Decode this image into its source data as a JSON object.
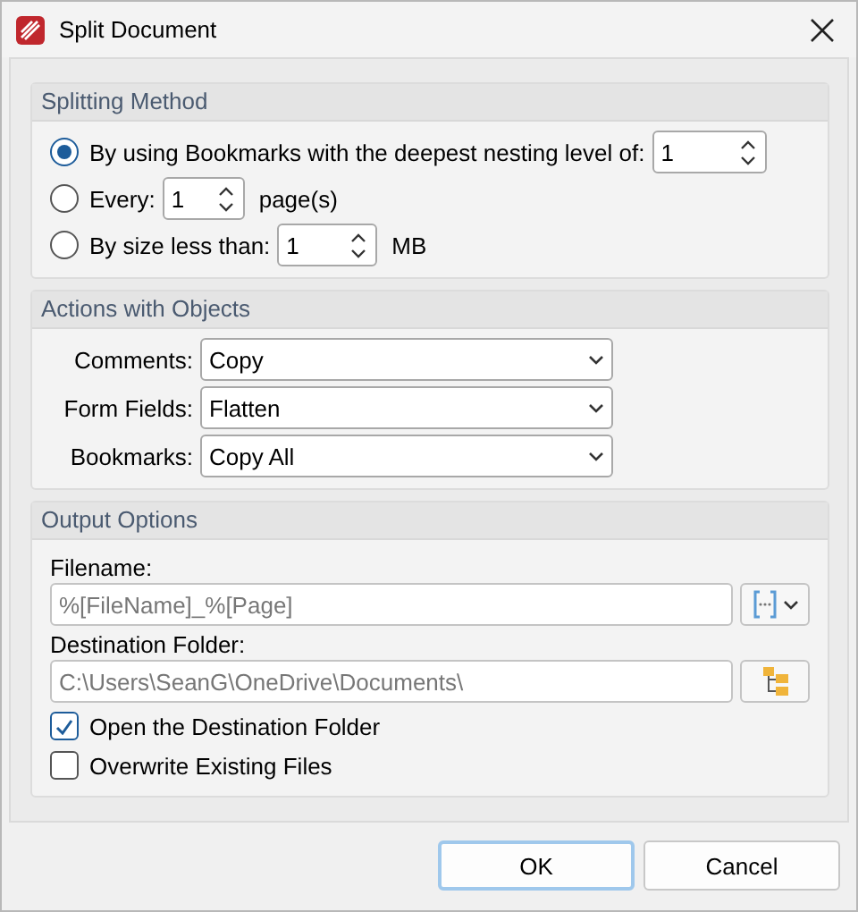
{
  "window": {
    "title": "Split Document"
  },
  "splitting_method": {
    "title": "Splitting Method",
    "options": [
      {
        "label": "By using Bookmarks with the deepest nesting level of:",
        "selected": true,
        "value": "1"
      },
      {
        "label": "Every:",
        "selected": false,
        "value": "1",
        "unit": "page(s)"
      },
      {
        "label": "By size less than:",
        "selected": false,
        "value": "1",
        "unit": "MB"
      }
    ]
  },
  "actions_with_objects": {
    "title": "Actions with Objects",
    "fields": [
      {
        "label": "Comments:",
        "value": "Copy"
      },
      {
        "label": "Form Fields:",
        "value": "Flatten"
      },
      {
        "label": "Bookmarks:",
        "value": "Copy All"
      }
    ]
  },
  "output_options": {
    "title": "Output Options",
    "filename": {
      "label": "Filename:",
      "value": "%[FileName]_%[Page]",
      "read_only": true
    },
    "destination_folder": {
      "label": "Destination Folder:",
      "value": "C:\\Users\\SeanG\\OneDrive\\Documents\\",
      "read_only": true
    },
    "checkboxes": [
      {
        "label": "Open the Destination Folder",
        "checked": true
      },
      {
        "label": "Overwrite Existing Files",
        "checked": false
      }
    ]
  },
  "buttons": [
    {
      "label": "OK",
      "default": true
    },
    {
      "label": "Cancel",
      "default": false
    }
  ]
}
